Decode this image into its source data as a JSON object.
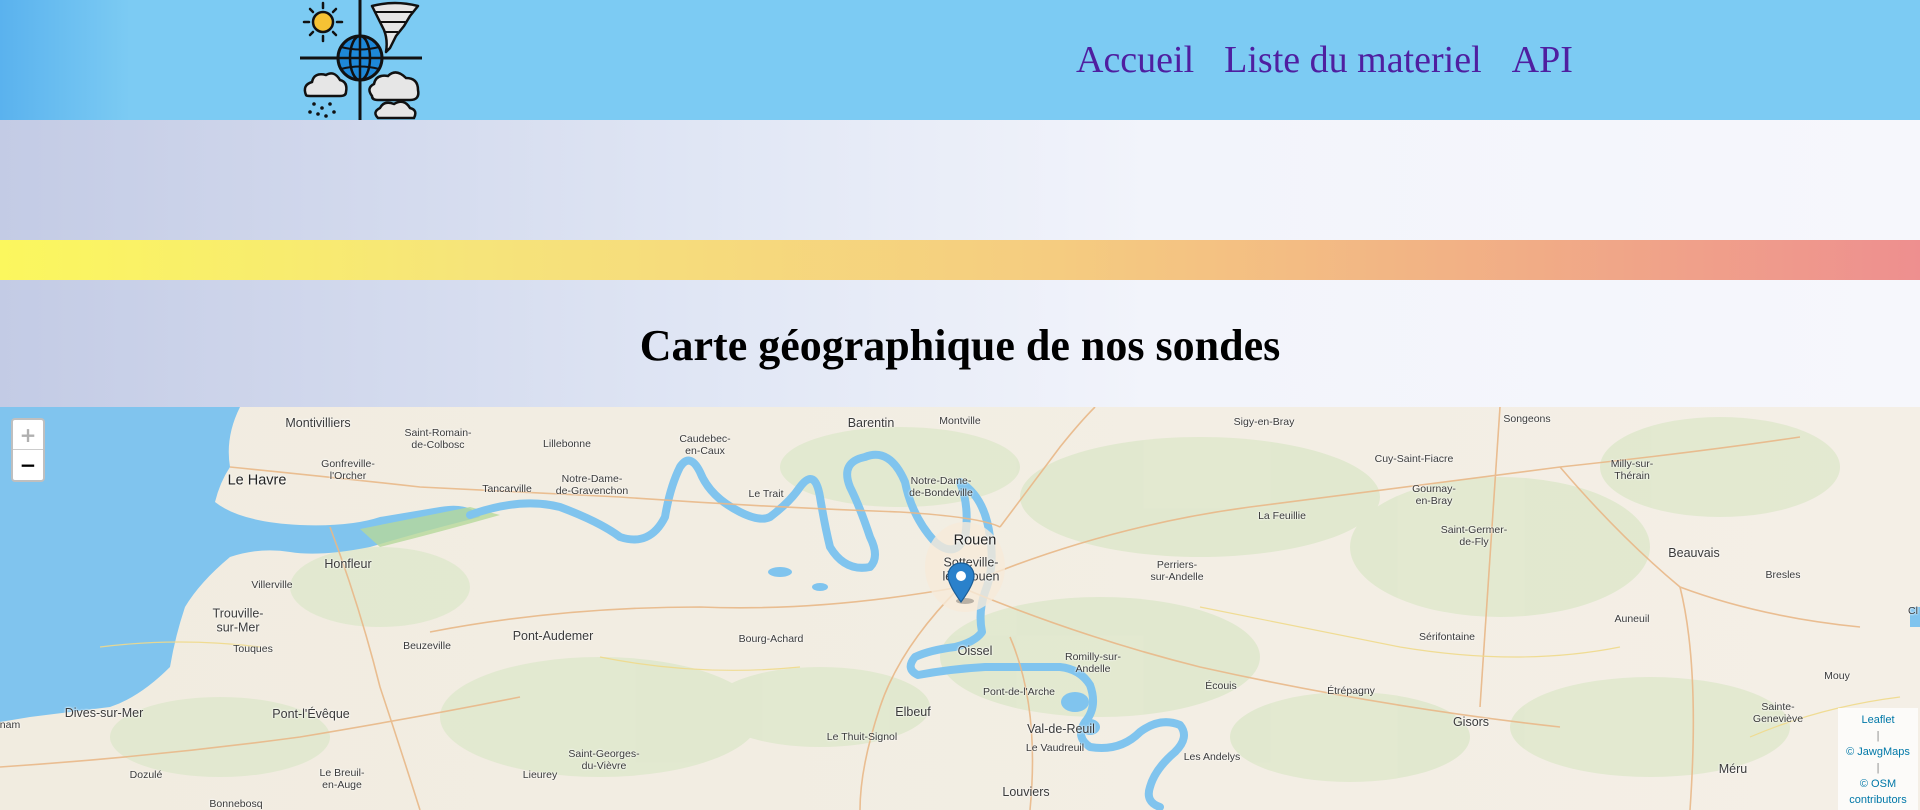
{
  "header": {
    "logo_icon": "weather-globe-logo-icon",
    "nav": [
      {
        "label": "Accueil"
      },
      {
        "label": "Liste du materiel"
      },
      {
        "label": "API"
      }
    ],
    "nav_color": "#4f1fa0",
    "background": "#7ccbf3"
  },
  "page": {
    "title": "Carte géographique de nos sondes",
    "stripe_colors": [
      "#fbf75e",
      "#ee8f8f"
    ]
  },
  "map": {
    "zoom_in": "+",
    "zoom_out": "−",
    "marker_icon": "map-marker-icon",
    "places": [
      "Montivilliers",
      "Saint-Romain-\nde-Colbosc",
      "Lillebonne",
      "Caudebec-\nen-Caux",
      "Barentin",
      "Montville",
      "Sigy-en-Bray",
      "Songeons",
      "Le Havre",
      "Gonfreville-\nl'Orcher",
      "Tancarville",
      "Notre-Dame-\nde-Gravenchon",
      "Le Trait",
      "Notre-Dame-\nde-Bondeville",
      "Cuy-Saint-Fiacre",
      "Milly-sur-\nThérain",
      "Gournay-\nen-Bray",
      "La Feuillie",
      "Saint-Germer-\nde-Fly",
      "Rouen",
      "Sotteville-\nlès-Rouen",
      "Honfleur",
      "Perriers-\nsur-Andelle",
      "Beauvais",
      "Villerville",
      "Bresles",
      "Trouville-\nsur-Mer",
      "Pont-Audemer",
      "Bourg-Achard",
      "Oissel",
      "Auneuil",
      "Sérifontaine",
      "Touques",
      "Beuzeville",
      "Romilly-sur-\nAndelle",
      "Écouis",
      "Étrépagny",
      "Mouy",
      "Dives-sur-Mer",
      "Pont-l'Évêque",
      "Elbeuf",
      "Pont-de-l'Arche",
      "Sainte-\nGeneviève",
      "Gisors",
      "Le Thuit-Signol",
      "Val-de-Reuil",
      "Le Vaudreuil",
      "Saint-Georges-\ndu-Vièvre",
      "Les Andelys",
      "Dozulé",
      "Le Breuil-\nen-Auge",
      "Lieurey",
      "Méru",
      "Louviers",
      "Bonnebosq",
      "nam",
      "Cl"
    ],
    "attribution": {
      "leaflet": "Leaflet",
      "jawg": "© JawgMaps",
      "osm": "© OSM contributors",
      "separator": "|"
    }
  }
}
